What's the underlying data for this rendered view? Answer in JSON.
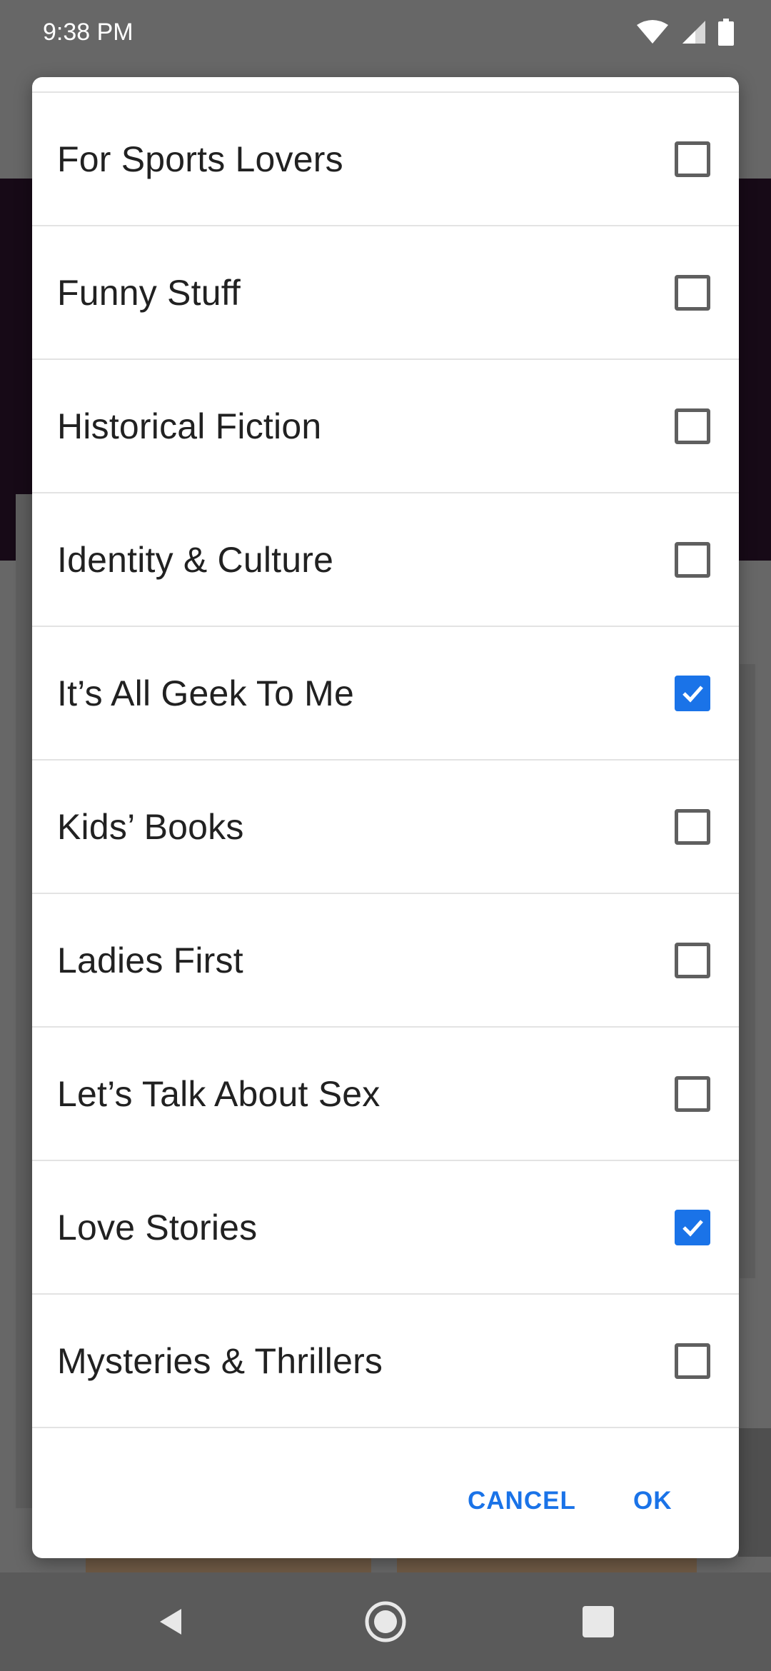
{
  "status_bar": {
    "time": "9:38 PM",
    "icons": [
      "wifi-icon",
      "signal-icon",
      "battery-icon"
    ]
  },
  "dialog": {
    "options": [
      {
        "label": "For Sports Lovers",
        "checked": false
      },
      {
        "label": "Funny Stuff",
        "checked": false
      },
      {
        "label": "Historical Fiction",
        "checked": false
      },
      {
        "label": "Identity & Culture",
        "checked": false
      },
      {
        "label": "It’s All Geek To Me",
        "checked": true
      },
      {
        "label": "Kids’ Books",
        "checked": false
      },
      {
        "label": "Ladies First",
        "checked": false
      },
      {
        "label": "Let’s Talk About Sex",
        "checked": false
      },
      {
        "label": "Love Stories",
        "checked": true
      },
      {
        "label": "Mysteries & Thrillers",
        "checked": false
      }
    ],
    "cancel_label": "CANCEL",
    "ok_label": "OK"
  },
  "nav_bar": {
    "icons": [
      "back-icon",
      "home-icon",
      "recents-icon"
    ]
  },
  "colors": {
    "accent": "#1a73e8",
    "scrim": "#676767",
    "checkbox_border": "#5f5f5f",
    "text": "#212121"
  }
}
